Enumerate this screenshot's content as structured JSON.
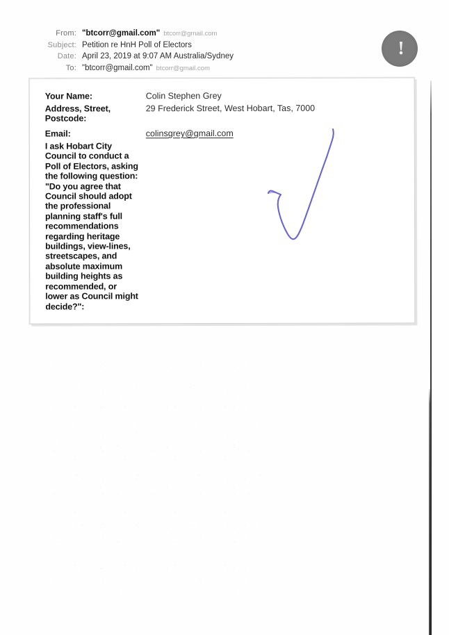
{
  "mail_header": {
    "rows": [
      {
        "label": "From:",
        "value": "\"btcorr@gmail.com\"",
        "bold": true,
        "sub": "btcorr@gmail.com"
      },
      {
        "label": "Subject:",
        "value": "Petition re HnH Poll of Electors",
        "bold": false,
        "sub": ""
      },
      {
        "label": "Date:",
        "value": "April 23, 2019 at 9:07 AM Australia/Sydney",
        "bold": false,
        "sub": ""
      },
      {
        "label": "To:",
        "value": "\"btcorr@gmail.com\"",
        "bold": false,
        "sub": "btcorr@gmail.com"
      }
    ]
  },
  "badge": {
    "symbol": "!"
  },
  "form": {
    "name_label": "Your Name:",
    "name_value": "Colin Stephen Grey",
    "address_label": "Address, Street, Postcode:",
    "address_value": "29 Frederick Street, West Hobart, Tas, 7000",
    "email_label": "Email:",
    "email_value": "colinsgrey@gmail.com",
    "petition_text": "I ask Hobart City Council to conduct a Poll of Electors, asking the following question: \"Do you agree that Council should adopt the professional planning staff's full recommendations regarding heritage buildings, view-lines, streetscapes, and absolute maximum building heights as recommended, or lower as Council might decide?\":"
  },
  "annotation": {
    "tick_color": "#5a5ac8"
  }
}
